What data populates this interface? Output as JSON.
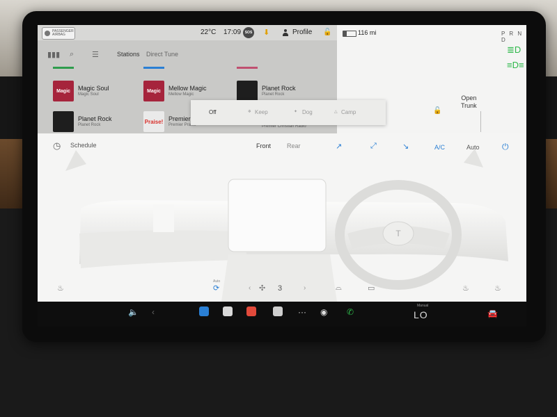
{
  "status": {
    "airbag_line1": "PASSENGER",
    "airbag_line2": "AIRBAG",
    "temperature": "22°C",
    "time": "17:09",
    "sos_label": "SOS",
    "profile_label": "Profile",
    "battery_level": 0.25,
    "range": "116 mi",
    "gear": "P R N D"
  },
  "media": {
    "tabs": [
      {
        "label": "Stations"
      },
      {
        "label": "Direct Tune"
      }
    ],
    "stations": [
      {
        "art": "Magic",
        "name": "Magic Soul",
        "sub": "Magic Soul"
      },
      {
        "art": "Magic",
        "name": "Mellow Magic",
        "sub": "Mellow Magic"
      },
      {
        "art": "",
        "name": "Planet Rock",
        "sub": "Planet Rock"
      },
      {
        "art": "",
        "name": "Planet Rock",
        "sub": "Planet Rock"
      },
      {
        "art": "Praise!",
        "name": "Premier",
        "sub": "Premier Praise"
      },
      {
        "art": "",
        "name": "",
        "sub": "Premier Christian Radio"
      }
    ]
  },
  "car": {
    "trunk_line1": "Open",
    "trunk_line2": "Trunk",
    "partial_left": "en",
    "partial_left2": "nk"
  },
  "climate_mode": {
    "options": [
      {
        "label": "Off",
        "selected": true
      },
      {
        "label": "Keep",
        "selected": false
      },
      {
        "label": "Dog",
        "selected": false
      },
      {
        "label": "Camp",
        "selected": false
      }
    ]
  },
  "climate": {
    "schedule_label": "Schedule",
    "front_label": "Front",
    "rear_label": "Rear",
    "ac_label": "A/C",
    "auto_label": "Auto",
    "fan_speed": "3",
    "air_label": "Auto"
  },
  "dock": {
    "temp_label": "LO",
    "manual_label": "Manual"
  },
  "colors": {
    "accent_blue": "#2a7fd4",
    "accent_green": "#2eb84a",
    "download_orange": "#e0a000"
  }
}
